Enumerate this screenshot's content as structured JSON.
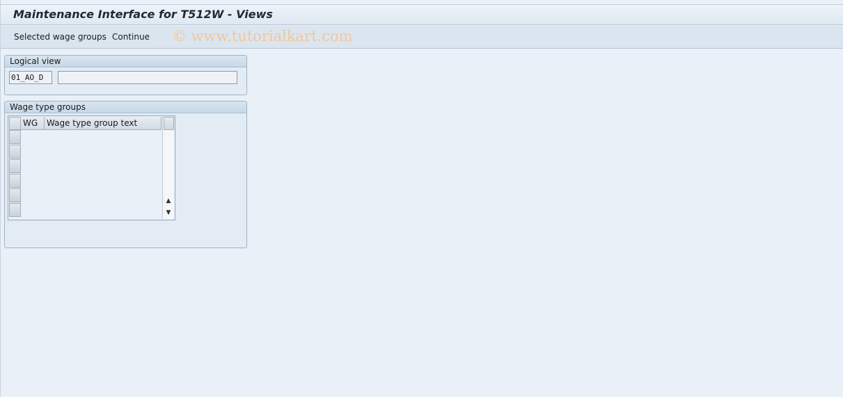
{
  "window": {
    "title": "Maintenance Interface for T512W - Views"
  },
  "toolbar": {
    "selected_wage_groups_label": "Selected wage groups",
    "continue_label": "Continue",
    "watermark": "© www.tutorialkart.com"
  },
  "logical_view": {
    "title": "Logical view",
    "value": "01_AO_D",
    "description": ""
  },
  "wage_type_groups": {
    "title": "Wage type groups",
    "columns": [
      "WG",
      "Wage type group text"
    ],
    "rows": []
  },
  "colors": {
    "background": "#e9f0f7",
    "toolbar": "#dbe5ef",
    "watermark": "#f1c79a"
  },
  "icons": {
    "scroll_up": "triangle-up-icon",
    "scroll_down": "triangle-down-icon"
  }
}
